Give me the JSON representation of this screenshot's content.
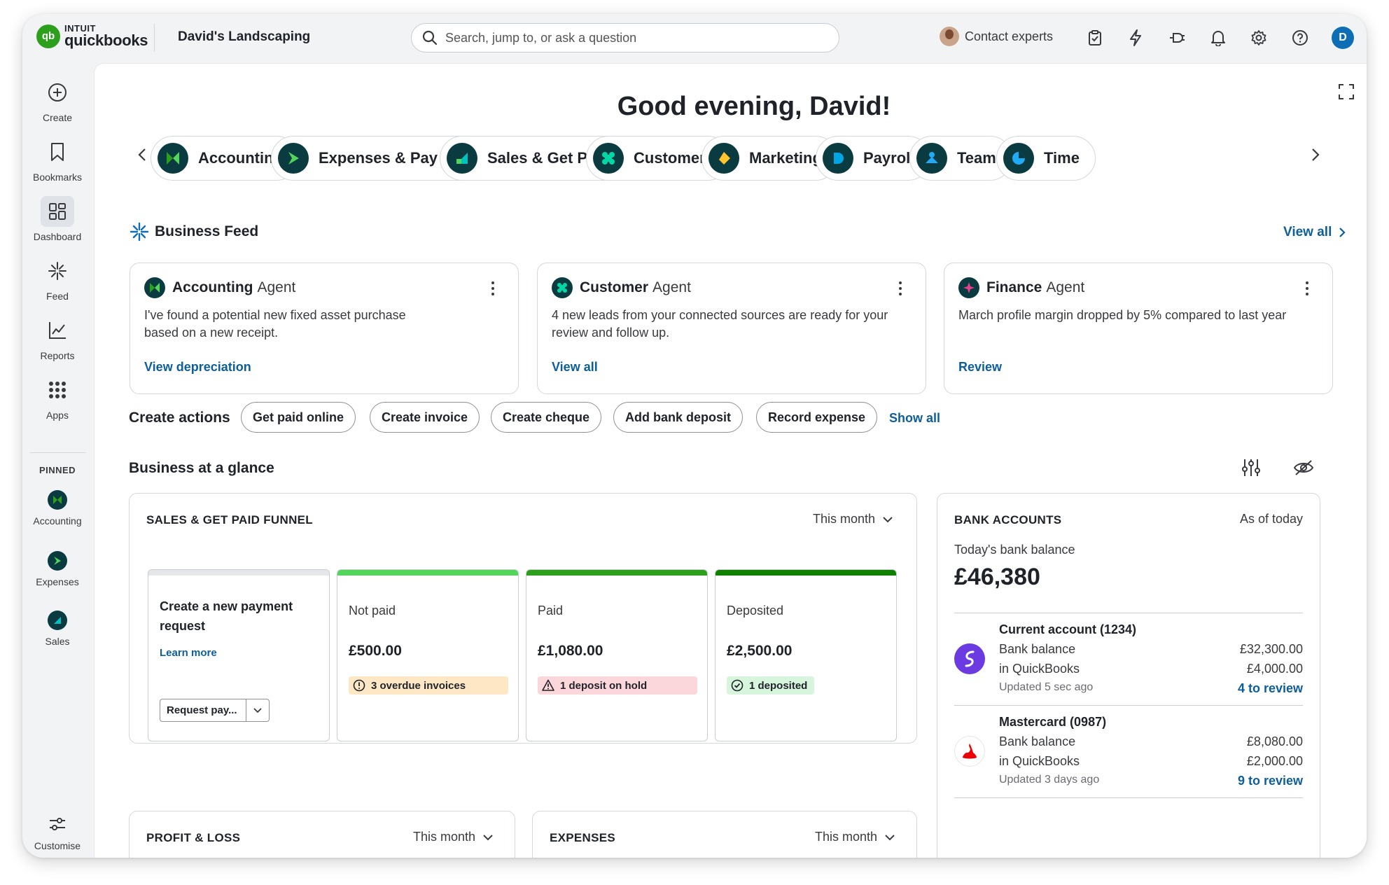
{
  "brand": {
    "intuit": "INTUIT",
    "product": "quickbooks",
    "logo_mark": "qb",
    "color": "#2ca01c"
  },
  "company": "David's Landscaping",
  "search": {
    "placeholder": "Search, jump to, or ask a question"
  },
  "topbar": {
    "contact_label": "Contact experts",
    "icons": [
      "clipboard-check-icon",
      "lightning-icon",
      "plug-icon",
      "bell-icon",
      "gear-icon",
      "help-icon"
    ],
    "user_initial": "D"
  },
  "rail": {
    "items": [
      {
        "label": "Create",
        "icon": "plus-circle-icon"
      },
      {
        "label": "Bookmarks",
        "icon": "bookmark-icon"
      },
      {
        "label": "Dashboard",
        "icon": "dashboard-icon",
        "active": true
      },
      {
        "label": "Feed",
        "icon": "sparkle-icon"
      },
      {
        "label": "Reports",
        "icon": "chart-line-icon"
      },
      {
        "label": "Apps",
        "icon": "grid-dots-icon"
      }
    ],
    "pinned_label": "PINNED",
    "pinned": [
      {
        "label": "Accounting"
      },
      {
        "label": "Expenses"
      },
      {
        "label": "Sales"
      }
    ],
    "customise_label": "Customise"
  },
  "greeting": "Good evening, David!",
  "chips": [
    {
      "label": "Accounting",
      "accent": "#2ca01c"
    },
    {
      "label": "Expenses & Pay Bills",
      "accent": "#2ca01c"
    },
    {
      "label": "Sales & Get Paid",
      "accent": "#00c1bf"
    },
    {
      "label": "Customers",
      "accent": "#00d7a6"
    },
    {
      "label": "Marketing",
      "accent": "#ffc72c"
    },
    {
      "label": "Payroll",
      "accent": "#00a6e4"
    },
    {
      "label": "Team",
      "accent": "#21abf6"
    },
    {
      "label": "Time",
      "accent": "#21abf6"
    }
  ],
  "feed": {
    "title": "Business Feed",
    "view_all": "View all",
    "cards": [
      {
        "name": "Accounting",
        "agent": "Agent",
        "body": "I've found a potential new fixed asset purchase based on a new receipt.",
        "link": "View depreciation"
      },
      {
        "name": "Customer",
        "agent": "Agent",
        "body": "4 new leads from your connected sources are ready for your review and follow up.",
        "link": "View all"
      },
      {
        "name": "Finance",
        "agent": "Agent",
        "body": "March profile margin dropped by 5% compared to last year",
        "link": "Review"
      }
    ]
  },
  "create_actions": {
    "title": "Create actions",
    "buttons": [
      "Get paid online",
      "Create invoice",
      "Create cheque",
      "Add bank deposit",
      "Record expense"
    ],
    "show_all": "Show all"
  },
  "glance": {
    "title": "Business at a glance",
    "funnel": {
      "title": "SALES & GET PAID FUNNEL",
      "period": "This month",
      "request": {
        "title": "Create a new payment request",
        "learn_more": "Learn more",
        "select": "Request pay..."
      },
      "stages": [
        {
          "label": "Not paid",
          "value": "£500.00",
          "badge": "3 overdue invoices",
          "bar_color": "#53d45b",
          "badge_bg": "#fde7c4",
          "badge_icon": "clock-alert-icon"
        },
        {
          "label": "Paid",
          "value": "£1,080.00",
          "badge": "1 deposit on hold",
          "bar_color": "#2ca01c",
          "badge_bg": "#fbd6db",
          "badge_icon": "warning-triangle-icon"
        },
        {
          "label": "Deposited",
          "value": "£2,500.00",
          "badge": "1 deposited",
          "bar_color": "#108000",
          "badge_bg": "#d6f5dc",
          "badge_icon": "check-circle-icon"
        }
      ]
    },
    "bank": {
      "title": "BANK ACCOUNTS",
      "as_of": "As of today",
      "balance_label": "Today's bank balance",
      "balance": "£46,380",
      "accounts": [
        {
          "name": "Current account (1234)",
          "row1": "Bank balance",
          "row2": "in QuickBooks",
          "val1": "£32,300.00",
          "val2": "£4,000.00",
          "updated": "Updated 5 sec ago",
          "review": "4 to review",
          "logo_color": "#6b3ae0"
        },
        {
          "name": "Mastercard (0987)",
          "row1": "Bank balance",
          "row2": "in QuickBooks",
          "val1": "£8,080.00",
          "val2": "£2,000.00",
          "updated": "Updated 3 days ago",
          "review": "9 to review",
          "logo_color": "#ec0000"
        }
      ]
    },
    "pl": {
      "title": "PROFIT & LOSS",
      "period": "This month"
    },
    "expenses": {
      "title": "EXPENSES",
      "period": "This month"
    }
  }
}
